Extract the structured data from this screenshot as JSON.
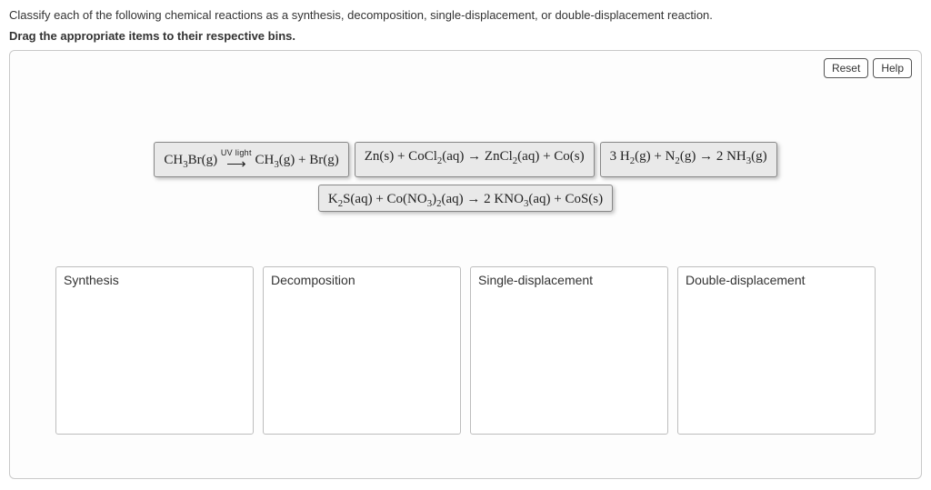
{
  "question": "Classify each of the following chemical reactions as a synthesis, decomposition, single-displacement, or double-displacement reaction.",
  "instruction": "Drag the appropriate items to their respective bins.",
  "buttons": {
    "reset": "Reset",
    "help": "Help"
  },
  "items": {
    "row1": {
      "a": {
        "part1": "CH",
        "sub1": "3",
        "part2": "Br(g)",
        "uv": "UV light",
        "part3": "CH",
        "sub2": "3",
        "part4": "(g) + Br(g)"
      },
      "b": {
        "p1": "Zn(s) + CoCl",
        "s1": "2",
        "p2": "(aq) → ZnCl",
        "s2": "2",
        "p3": "(aq) + Co(s)"
      },
      "c": {
        "p1": "3 H",
        "s1": "2",
        "p2": "(g) + N",
        "s2": "2",
        "p3": "(g) → 2 NH",
        "s3": "3",
        "p4": "(g)"
      }
    },
    "row2": {
      "d": {
        "p1": "K",
        "s1": "2",
        "p2": "S(aq) + Co(NO",
        "s2": "3",
        "p3": ")",
        "s3": "2",
        "p4": "(aq) → 2 KNO",
        "s4": "3",
        "p5": "(aq) + CoS(s)"
      }
    }
  },
  "bins": {
    "a": "Synthesis",
    "b": "Decomposition",
    "c": "Single-displacement",
    "d": "Double-displacement"
  }
}
